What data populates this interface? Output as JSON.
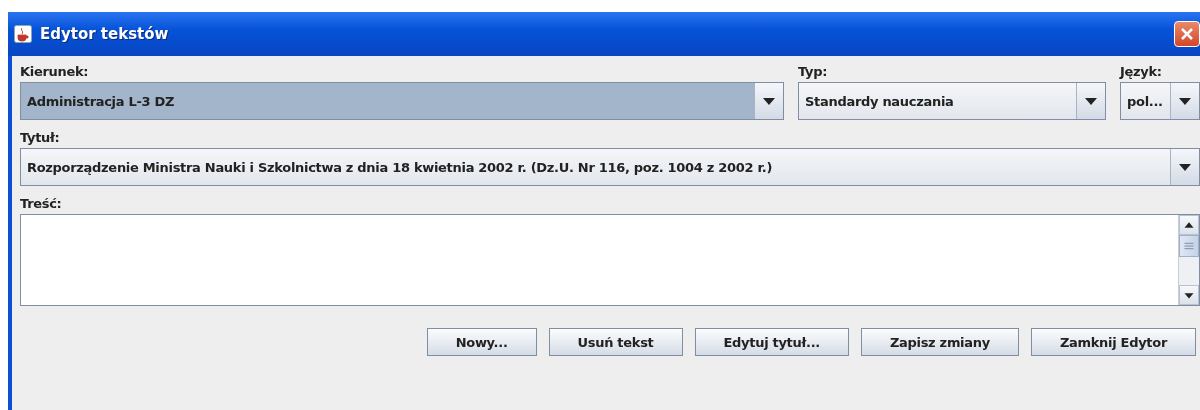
{
  "window": {
    "title": "Edytor tekstów"
  },
  "fields_row": [
    {
      "label": "Kierunek:",
      "value": "Administracja L-3 DZ",
      "focused": true
    },
    {
      "label": "Typ:",
      "value": "Standardy nauczania",
      "focused": false
    },
    {
      "label": "Język:",
      "value": "pol...",
      "focused": false
    }
  ],
  "title_field": {
    "label": "Tytuł:",
    "value": "Rozporządzenie Ministra Nauki i Szkolnictwa z dnia 18 kwietnia 2002 r. (Dz.U. Nr 116, poz. 1004 z 2002 r.)",
    "focused": false
  },
  "content": {
    "label": "Treść:"
  },
  "buttons": [
    "Nowy...",
    "Usuń tekst",
    "Edytuj tytuł...",
    "Zapisz zmiany",
    "Zamknij Edytor"
  ]
}
